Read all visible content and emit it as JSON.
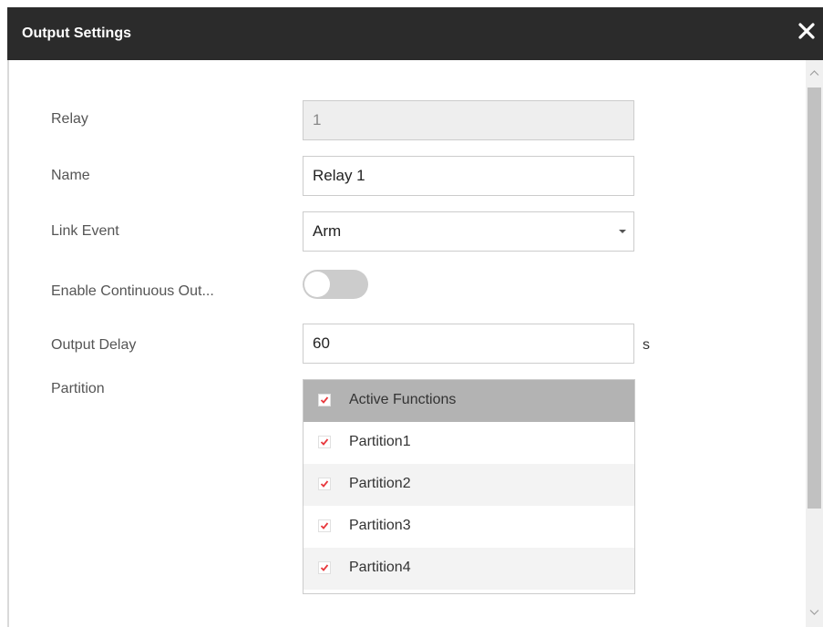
{
  "dialog": {
    "title": "Output Settings",
    "close_icon": "close-icon"
  },
  "form": {
    "relay": {
      "label": "Relay",
      "value": "1"
    },
    "name": {
      "label": "Name",
      "value": "Relay 1"
    },
    "link_event": {
      "label": "Link Event",
      "value": "Arm"
    },
    "continuous_output": {
      "label": "Enable Continuous Out...",
      "enabled": false
    },
    "output_delay": {
      "label": "Output Delay",
      "value": "60",
      "unit": "s"
    },
    "partition": {
      "label": "Partition",
      "header": "Active Functions",
      "items": [
        {
          "label": "Partition1",
          "checked": true
        },
        {
          "label": "Partition2",
          "checked": true
        },
        {
          "label": "Partition3",
          "checked": true
        },
        {
          "label": "Partition4",
          "checked": true
        }
      ]
    }
  },
  "colors": {
    "titlebar": "#2b2b2b",
    "check_accent": "#e8383d",
    "header_row": "#b3b3b3"
  }
}
